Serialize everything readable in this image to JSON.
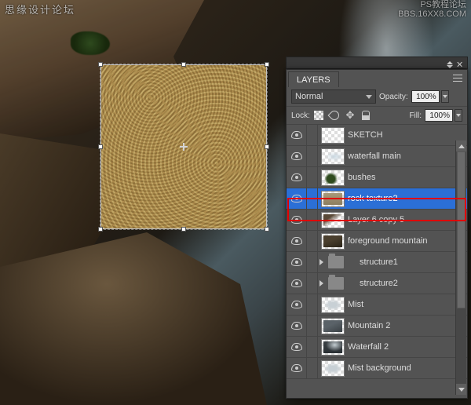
{
  "watermark": {
    "left": "思缘设计论坛",
    "right_top": "PS教程论坛",
    "right_bottom": "BBS.16XX8.COM"
  },
  "panel": {
    "title": "LAYERS",
    "blend_mode": "Normal",
    "opacity_label": "Opacity:",
    "opacity_value": "100%",
    "lock_label": "Lock:",
    "fill_label": "Fill:",
    "fill_value": "100%"
  },
  "layers": [
    {
      "name": "SKETCH",
      "visible": true,
      "type": "layer",
      "thumb": "th-sketch"
    },
    {
      "name": "waterfall main",
      "visible": true,
      "type": "layer",
      "thumb": "th-water"
    },
    {
      "name": "bushes",
      "visible": true,
      "type": "layer",
      "thumb": "th-bush"
    },
    {
      "name": "rock texture2",
      "visible": true,
      "type": "layer",
      "thumb": "th-rock",
      "selected": true
    },
    {
      "name": "Layer 6 copy 5",
      "visible": true,
      "type": "layer",
      "thumb": "th-layer6"
    },
    {
      "name": "foreground mountain",
      "visible": true,
      "type": "layer",
      "thumb": "th-fg"
    },
    {
      "name": "structure1",
      "visible": true,
      "type": "group"
    },
    {
      "name": "structure2",
      "visible": true,
      "type": "group"
    },
    {
      "name": "Mist",
      "visible": true,
      "type": "layer",
      "thumb": "th-mist"
    },
    {
      "name": "Mountain 2",
      "visible": true,
      "type": "layer",
      "thumb": "th-mtn"
    },
    {
      "name": "Waterfall 2",
      "visible": true,
      "type": "layer",
      "thumb": "th-wf2"
    },
    {
      "name": "Mist background",
      "visible": true,
      "type": "layer",
      "thumb": "th-mist"
    }
  ]
}
